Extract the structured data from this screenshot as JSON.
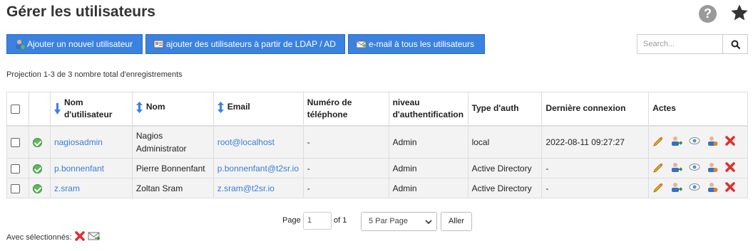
{
  "page": {
    "title": "Gérer les utilisateurs"
  },
  "toolbar": {
    "add_user": "Ajouter un nouvel utilisateur",
    "add_ldap": "ajouter des utilisateurs à partir de LDAP / AD",
    "email_all": "e-mail à tous les utilisateurs"
  },
  "search": {
    "placeholder": "Search..."
  },
  "summary": "Projection 1-3 de 3 nombre total d'enregistrements",
  "table": {
    "headers": {
      "username_1": "Nom",
      "username_2": "d'utilisateur",
      "name": "Nom",
      "email": "Email",
      "phone_1": "Numéro de",
      "phone_2": "téléphone",
      "level_1": "niveau",
      "level_2": "d'authentification",
      "auth_type": "Type d'auth",
      "last_login": "Dernière connexion",
      "actions": "Actes"
    },
    "rows": [
      {
        "username": "nagiosadmin",
        "name_1": "Nagios",
        "name_2": "Administrator",
        "email": "root@localhost",
        "phone": "-",
        "level": "Admin",
        "auth_type": "local",
        "last_login": "2022-08-11 09:27:27"
      },
      {
        "username": "p.bonnenfant",
        "name": "Pierre Bonnenfant",
        "email": "p.bonnenfant@t2sr.io",
        "phone": "-",
        "level": "Admin",
        "auth_type": "Active Directory",
        "last_login": "-"
      },
      {
        "username": "z.sram",
        "name": "Zoltan Sram",
        "email": "z.sram@t2sr.io",
        "phone": "-",
        "level": "Admin",
        "auth_type": "Active Directory",
        "last_login": "-"
      }
    ]
  },
  "pagination": {
    "page_label": "Page",
    "page_value": "1",
    "of_label": "of 1",
    "per_page": "5 Par Page",
    "go": "Aller"
  },
  "bulk": {
    "label": "Avec sélectionnés:"
  },
  "colors": {
    "primary": "#3b82e0",
    "link": "#3b7dd8",
    "danger": "#e0302a",
    "success": "#5cb85c"
  }
}
